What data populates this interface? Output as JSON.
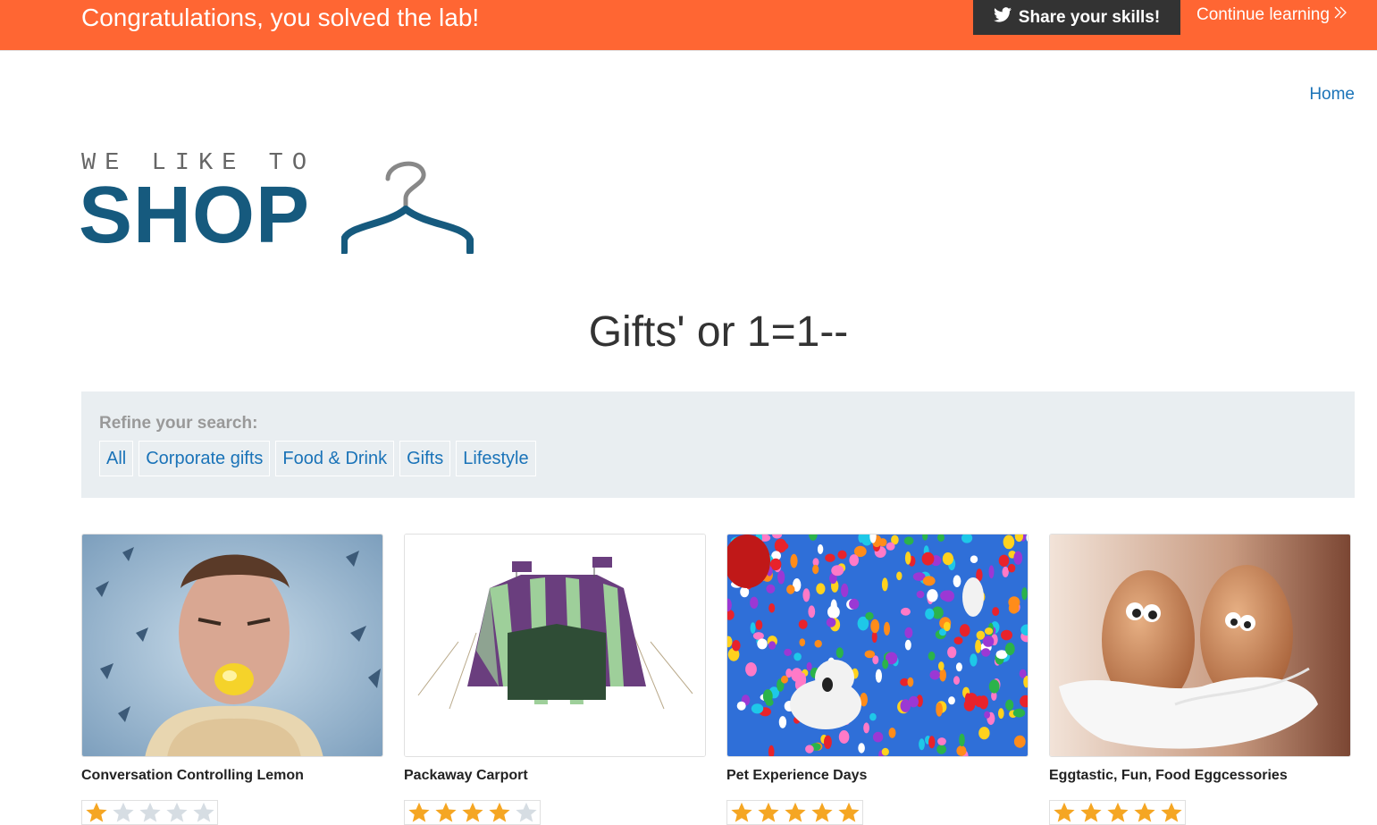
{
  "banner": {
    "message": "Congratulations, you solved the lab!",
    "share_label": "Share your skills!",
    "continue_label": "Continue learning"
  },
  "nav": {
    "home_label": "Home"
  },
  "logo": {
    "top_text": "WE LIKE TO",
    "main_text": "SHOP"
  },
  "page": {
    "title": "Gifts' or 1=1--"
  },
  "filter": {
    "label": "Refine your search:",
    "items": [
      "All",
      "Corporate gifts",
      "Food & Drink",
      "Gifts",
      "Lifestyle"
    ]
  },
  "products": [
    {
      "name": "Conversation Controlling Lemon",
      "rating": 1,
      "max_rating": 5
    },
    {
      "name": "Packaway Carport",
      "rating": 4,
      "max_rating": 5
    },
    {
      "name": "Pet Experience Days",
      "rating": 5,
      "max_rating": 5
    },
    {
      "name": "Eggtastic, Fun, Food Eggcessories",
      "rating": 5,
      "max_rating": 5
    }
  ],
  "colors": {
    "banner": "#ff6633",
    "brand": "#165a7e",
    "link": "#1a73b8",
    "star_filled": "#f5a623",
    "star_empty": "#d6dde3"
  }
}
